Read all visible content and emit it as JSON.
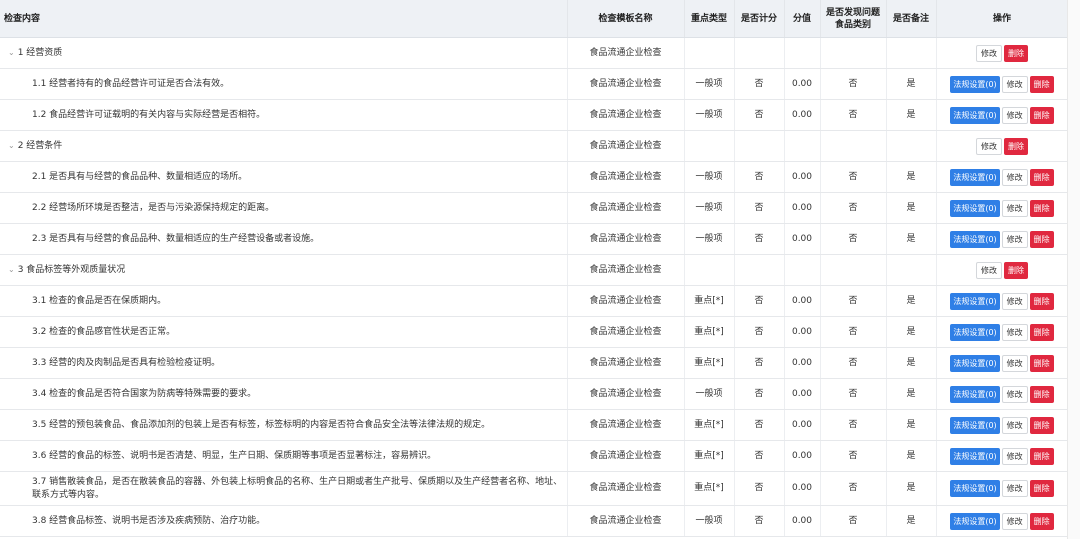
{
  "headers": [
    "检查内容",
    "检查模板名称",
    "重点类型",
    "是否计分",
    "分值",
    "是否发现问题食品类别",
    "是否备注",
    "操作"
  ],
  "buttons": {
    "law": "法规设置(0)",
    "edit": "修改",
    "delete": "删除"
  },
  "colors": {
    "header_bg": "#eef1f5",
    "law_button": "#2f7fe6",
    "delete_button": "#e0283f"
  },
  "rows": [
    {
      "level": 1,
      "content": "1 经营资质",
      "template": "食品流通企业检查"
    },
    {
      "level": 2,
      "content": "1.1 经营者持有的食品经营许可证是否合法有效。",
      "template": "食品流通企业检查",
      "type": "一般项",
      "scored": "否",
      "value": "0.00",
      "found": "否",
      "remark": "是"
    },
    {
      "level": 2,
      "content": "1.2 食品经营许可证载明的有关内容与实际经营是否相符。",
      "template": "食品流通企业检查",
      "type": "一般项",
      "scored": "否",
      "value": "0.00",
      "found": "否",
      "remark": "是"
    },
    {
      "level": 1,
      "content": "2 经营条件",
      "template": "食品流通企业检查"
    },
    {
      "level": 2,
      "content": "2.1 是否具有与经营的食品品种、数量相适应的场所。",
      "template": "食品流通企业检查",
      "type": "一般项",
      "scored": "否",
      "value": "0.00",
      "found": "否",
      "remark": "是"
    },
    {
      "level": 2,
      "content": "2.2 经营场所环境是否整洁，是否与污染源保持规定的距离。",
      "template": "食品流通企业检查",
      "type": "一般项",
      "scored": "否",
      "value": "0.00",
      "found": "否",
      "remark": "是"
    },
    {
      "level": 2,
      "content": "2.3 是否具有与经营的食品品种、数量相适应的生产经营设备或者设施。",
      "template": "食品流通企业检查",
      "type": "一般项",
      "scored": "否",
      "value": "0.00",
      "found": "否",
      "remark": "是"
    },
    {
      "level": 1,
      "content": "3 食品标签等外观质量状况",
      "template": "食品流通企业检查"
    },
    {
      "level": 2,
      "content": "3.1 检查的食品是否在保质期内。",
      "template": "食品流通企业检查",
      "type": "重点[*]",
      "scored": "否",
      "value": "0.00",
      "found": "否",
      "remark": "是"
    },
    {
      "level": 2,
      "content": "3.2 检查的食品感官性状是否正常。",
      "template": "食品流通企业检查",
      "type": "重点[*]",
      "scored": "否",
      "value": "0.00",
      "found": "否",
      "remark": "是"
    },
    {
      "level": 2,
      "content": "3.3 经营的肉及肉制品是否具有检验检疫证明。",
      "template": "食品流通企业检查",
      "type": "重点[*]",
      "scored": "否",
      "value": "0.00",
      "found": "否",
      "remark": "是"
    },
    {
      "level": 2,
      "content": "3.4 检查的食品是否符合国家为防病等特殊需要的要求。",
      "template": "食品流通企业检查",
      "type": "一般项",
      "scored": "否",
      "value": "0.00",
      "found": "否",
      "remark": "是"
    },
    {
      "level": 2,
      "content": "3.5 经营的预包装食品、食品添加剂的包装上是否有标签，标签标明的内容是否符合食品安全法等法律法规的规定。",
      "template": "食品流通企业检查",
      "type": "重点[*]",
      "scored": "否",
      "value": "0.00",
      "found": "否",
      "remark": "是"
    },
    {
      "level": 2,
      "content": "3.6 经营的食品的标签、说明书是否清楚、明显，生产日期、保质期等事项是否显著标注，容易辨识。",
      "template": "食品流通企业检查",
      "type": "重点[*]",
      "scored": "否",
      "value": "0.00",
      "found": "否",
      "remark": "是"
    },
    {
      "level": 2,
      "content": "3.7 销售散装食品，是否在散装食品的容器、外包装上标明食品的名称、生产日期或者生产批号、保质期以及生产经营者名称、地址、联系方式等内容。",
      "template": "食品流通企业检查",
      "type": "重点[*]",
      "scored": "否",
      "value": "0.00",
      "found": "否",
      "remark": "是",
      "tall": true
    },
    {
      "level": 2,
      "content": "3.8 经营食品标签、说明书是否涉及疾病预防、治疗功能。",
      "template": "食品流通企业检查",
      "type": "一般项",
      "scored": "否",
      "value": "0.00",
      "found": "否",
      "remark": "是"
    }
  ]
}
